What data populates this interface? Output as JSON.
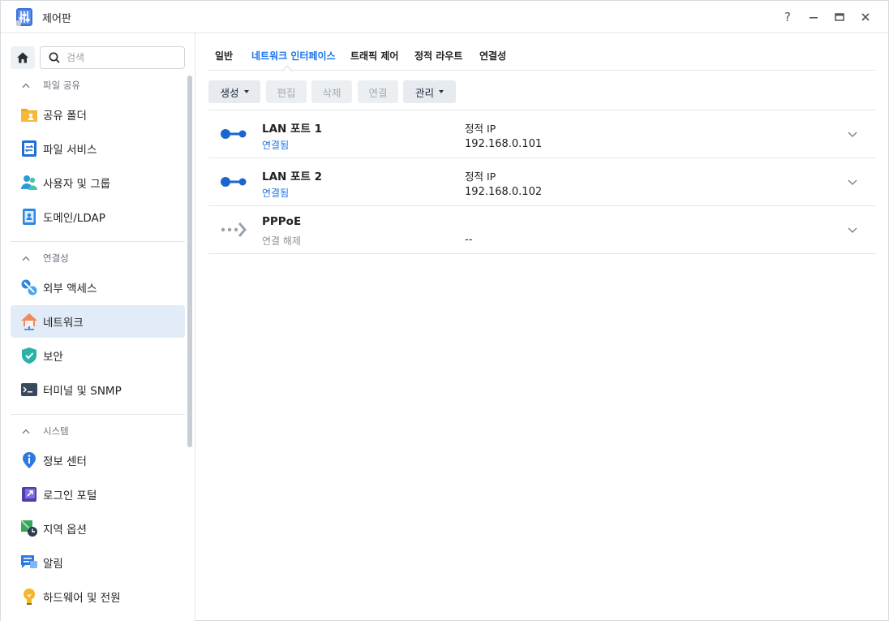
{
  "window": {
    "title": "제어판"
  },
  "titlebar_buttons": {
    "help": "?"
  },
  "search": {
    "placeholder": "검색"
  },
  "sidebar": {
    "sections": [
      {
        "label": "파일 공유",
        "items": [
          {
            "label": "공유 폴더",
            "icon": "shared-folder-icon"
          },
          {
            "label": "파일 서비스",
            "icon": "file-services-icon"
          },
          {
            "label": "사용자 및 그룹",
            "icon": "users-groups-icon"
          },
          {
            "label": "도메인/LDAP",
            "icon": "domain-ldap-icon"
          }
        ]
      },
      {
        "label": "연결성",
        "items": [
          {
            "label": "외부 액세스",
            "icon": "external-access-icon"
          },
          {
            "label": "네트워크",
            "icon": "network-icon",
            "active": true
          },
          {
            "label": "보안",
            "icon": "security-shield-icon"
          },
          {
            "label": "터미널 및 SNMP",
            "icon": "terminal-icon"
          }
        ]
      },
      {
        "label": "시스템",
        "items": [
          {
            "label": "정보 센터",
            "icon": "info-center-icon"
          },
          {
            "label": "로그인 포털",
            "icon": "login-portal-icon"
          },
          {
            "label": "지역 옵션",
            "icon": "regional-options-icon"
          },
          {
            "label": "알림",
            "icon": "notification-icon"
          },
          {
            "label": "하드웨어 및 전원",
            "icon": "hardware-power-icon"
          }
        ]
      }
    ]
  },
  "tabs": [
    {
      "label": "일반"
    },
    {
      "label": "네트워크 인터페이스",
      "active": true
    },
    {
      "label": "트래픽 제어"
    },
    {
      "label": "정적 라우트"
    },
    {
      "label": "연결성"
    }
  ],
  "toolbar": {
    "create": "생성",
    "edit": "편집",
    "delete": "삭제",
    "connect": "연결",
    "manage": "관리"
  },
  "interfaces": [
    {
      "name": "LAN 포트 1",
      "status": "연결됨",
      "type": "정적 IP",
      "ip": "192.168.0.101",
      "connected": true
    },
    {
      "name": "LAN 포트 2",
      "status": "연결됨",
      "type": "정적 IP",
      "ip": "192.168.0.102",
      "connected": true
    },
    {
      "name": "PPPoE",
      "status": "연결 해제",
      "type": "",
      "ip": "--",
      "connected": false
    }
  ],
  "colors": {
    "accent": "#1a73e8",
    "active_bg": "#e1ecf8"
  }
}
